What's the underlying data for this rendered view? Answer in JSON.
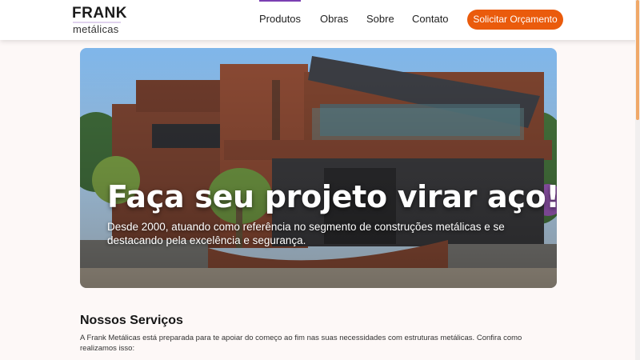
{
  "brand": {
    "name_top": "FRANK",
    "name_bottom": "metálicas"
  },
  "nav": {
    "items": [
      {
        "label": "Produtos"
      },
      {
        "label": "Obras"
      },
      {
        "label": "Sobre"
      },
      {
        "label": "Contato"
      }
    ],
    "cta_label": "Solicitar Orçamento"
  },
  "hero": {
    "title": "Faça seu projeto virar aço!",
    "subtitle": "Desde 2000, atuando como referência no segmento de construções metálicas e se destacando pela excelência e segurança."
  },
  "services": {
    "title": "Nossos Serviços",
    "description": "A Frank Metálicas está preparada para te apoiar do começo ao fim nas suas necessidades com estruturas metálicas. Confira como realizamos isso:"
  },
  "colors": {
    "accent": "#ea5b0c",
    "nav_active": "#7b3fb2",
    "background": "#fdf8f7"
  }
}
